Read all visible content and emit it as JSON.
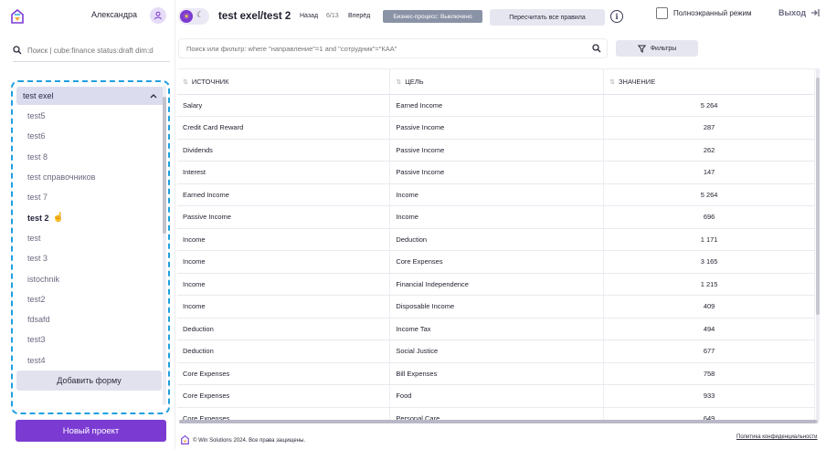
{
  "sidebar": {
    "user_name": "Александра",
    "search_placeholder": "Поиск | cube:finance status:draft dim:d",
    "folder": "test exel",
    "forms": [
      "test5",
      "test6",
      "test 8",
      "test справочников",
      "test 7",
      "test 2",
      "test",
      "test 3",
      "istochnik",
      "test2",
      "fdsafd",
      "test3",
      "test4"
    ],
    "active_form": "test 2",
    "add_form_label": "Добавить форму",
    "new_project_label": "Новый проект"
  },
  "header": {
    "title": "test exel/test 2",
    "back": "Назад",
    "position": "6/13",
    "forward": "Вперёд",
    "bp_badge": "Бизнес-процесс: Выключено",
    "recalc_label": "Пересчитать все правила",
    "fullscreen_label": "Полноэкранный режим",
    "logout_label": "Выход"
  },
  "filter": {
    "placeholder": "Поиск или фильтр: where \"направление\"=1 and \"сотрудник\"=\"КАА\"",
    "filters_label": "Фильтры"
  },
  "table": {
    "headers": [
      "ИСТОЧНИК",
      "ЦЕЛЬ",
      "ЗНАЧЕНИЕ"
    ],
    "rows": [
      [
        "Salary",
        "Earned Income",
        "5 264"
      ],
      [
        "Credit Card Reward",
        "Passive Income",
        "287"
      ],
      [
        "Dividends",
        "Passive Income",
        "262"
      ],
      [
        "Interest",
        "Passive Income",
        "147"
      ],
      [
        "Earned Income",
        "Income",
        "5 264"
      ],
      [
        "Passive Income",
        "Income",
        "696"
      ],
      [
        "Income",
        "Deduction",
        "1 171"
      ],
      [
        "Income",
        "Core Expenses",
        "3 165"
      ],
      [
        "Income",
        "Financial Independence",
        "1 215"
      ],
      [
        "Income",
        "Disposable Income",
        "409"
      ],
      [
        "Deduction",
        "Income Tax",
        "494"
      ],
      [
        "Deduction",
        "Social Justice",
        "677"
      ],
      [
        "Core Expenses",
        "Bill Expenses",
        "758"
      ],
      [
        "Core Expenses",
        "Food",
        "933"
      ],
      [
        "Core Expenses",
        "Personal Care",
        "649"
      ]
    ]
  },
  "footer": {
    "copyright": "© Win Solutions 2024. Все права защищены.",
    "privacy": "Политика конфиденциальности"
  },
  "colors": {
    "accent": "#7b3bd3",
    "highlight_border": "#1e9fdf",
    "badge": "#8a93a6"
  }
}
